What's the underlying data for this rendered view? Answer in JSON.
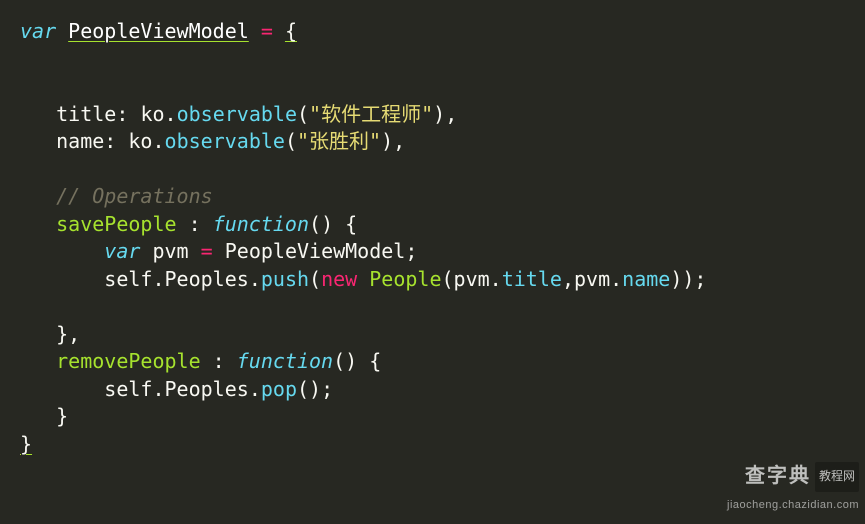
{
  "code": {
    "t_var": "var",
    "t_PVM": "PeopleViewModel",
    "t_space": " ",
    "t_eq": "=",
    "t_lbrace": "{",
    "t_rbrace": "}",
    "t_lparen": "(",
    "t_rparen": ")",
    "t_semi": ";",
    "t_colon": ":",
    "t_comma": ",",
    "t_dot": ".",
    "t_title": "title",
    "t_name": "name",
    "t_ko": "ko",
    "t_observable": "observable",
    "str_title": "\"软件工程师\"",
    "str_name": "\"张胜利\"",
    "comment_ops": "// Operations",
    "t_savePeople": "savePeople",
    "t_removePeople": "removePeople",
    "t_function": "function",
    "t_pvm": "pvm",
    "t_self": "self",
    "t_Peoples": "Peoples",
    "t_push": "push",
    "t_pop": "pop",
    "t_new": "new",
    "t_People": "People",
    "t_titleProp": "title",
    "t_nameProp": "name"
  },
  "watermark": {
    "brand": "查字典",
    "tag": "教程网",
    "url": "jiaocheng.chazidian.com"
  }
}
